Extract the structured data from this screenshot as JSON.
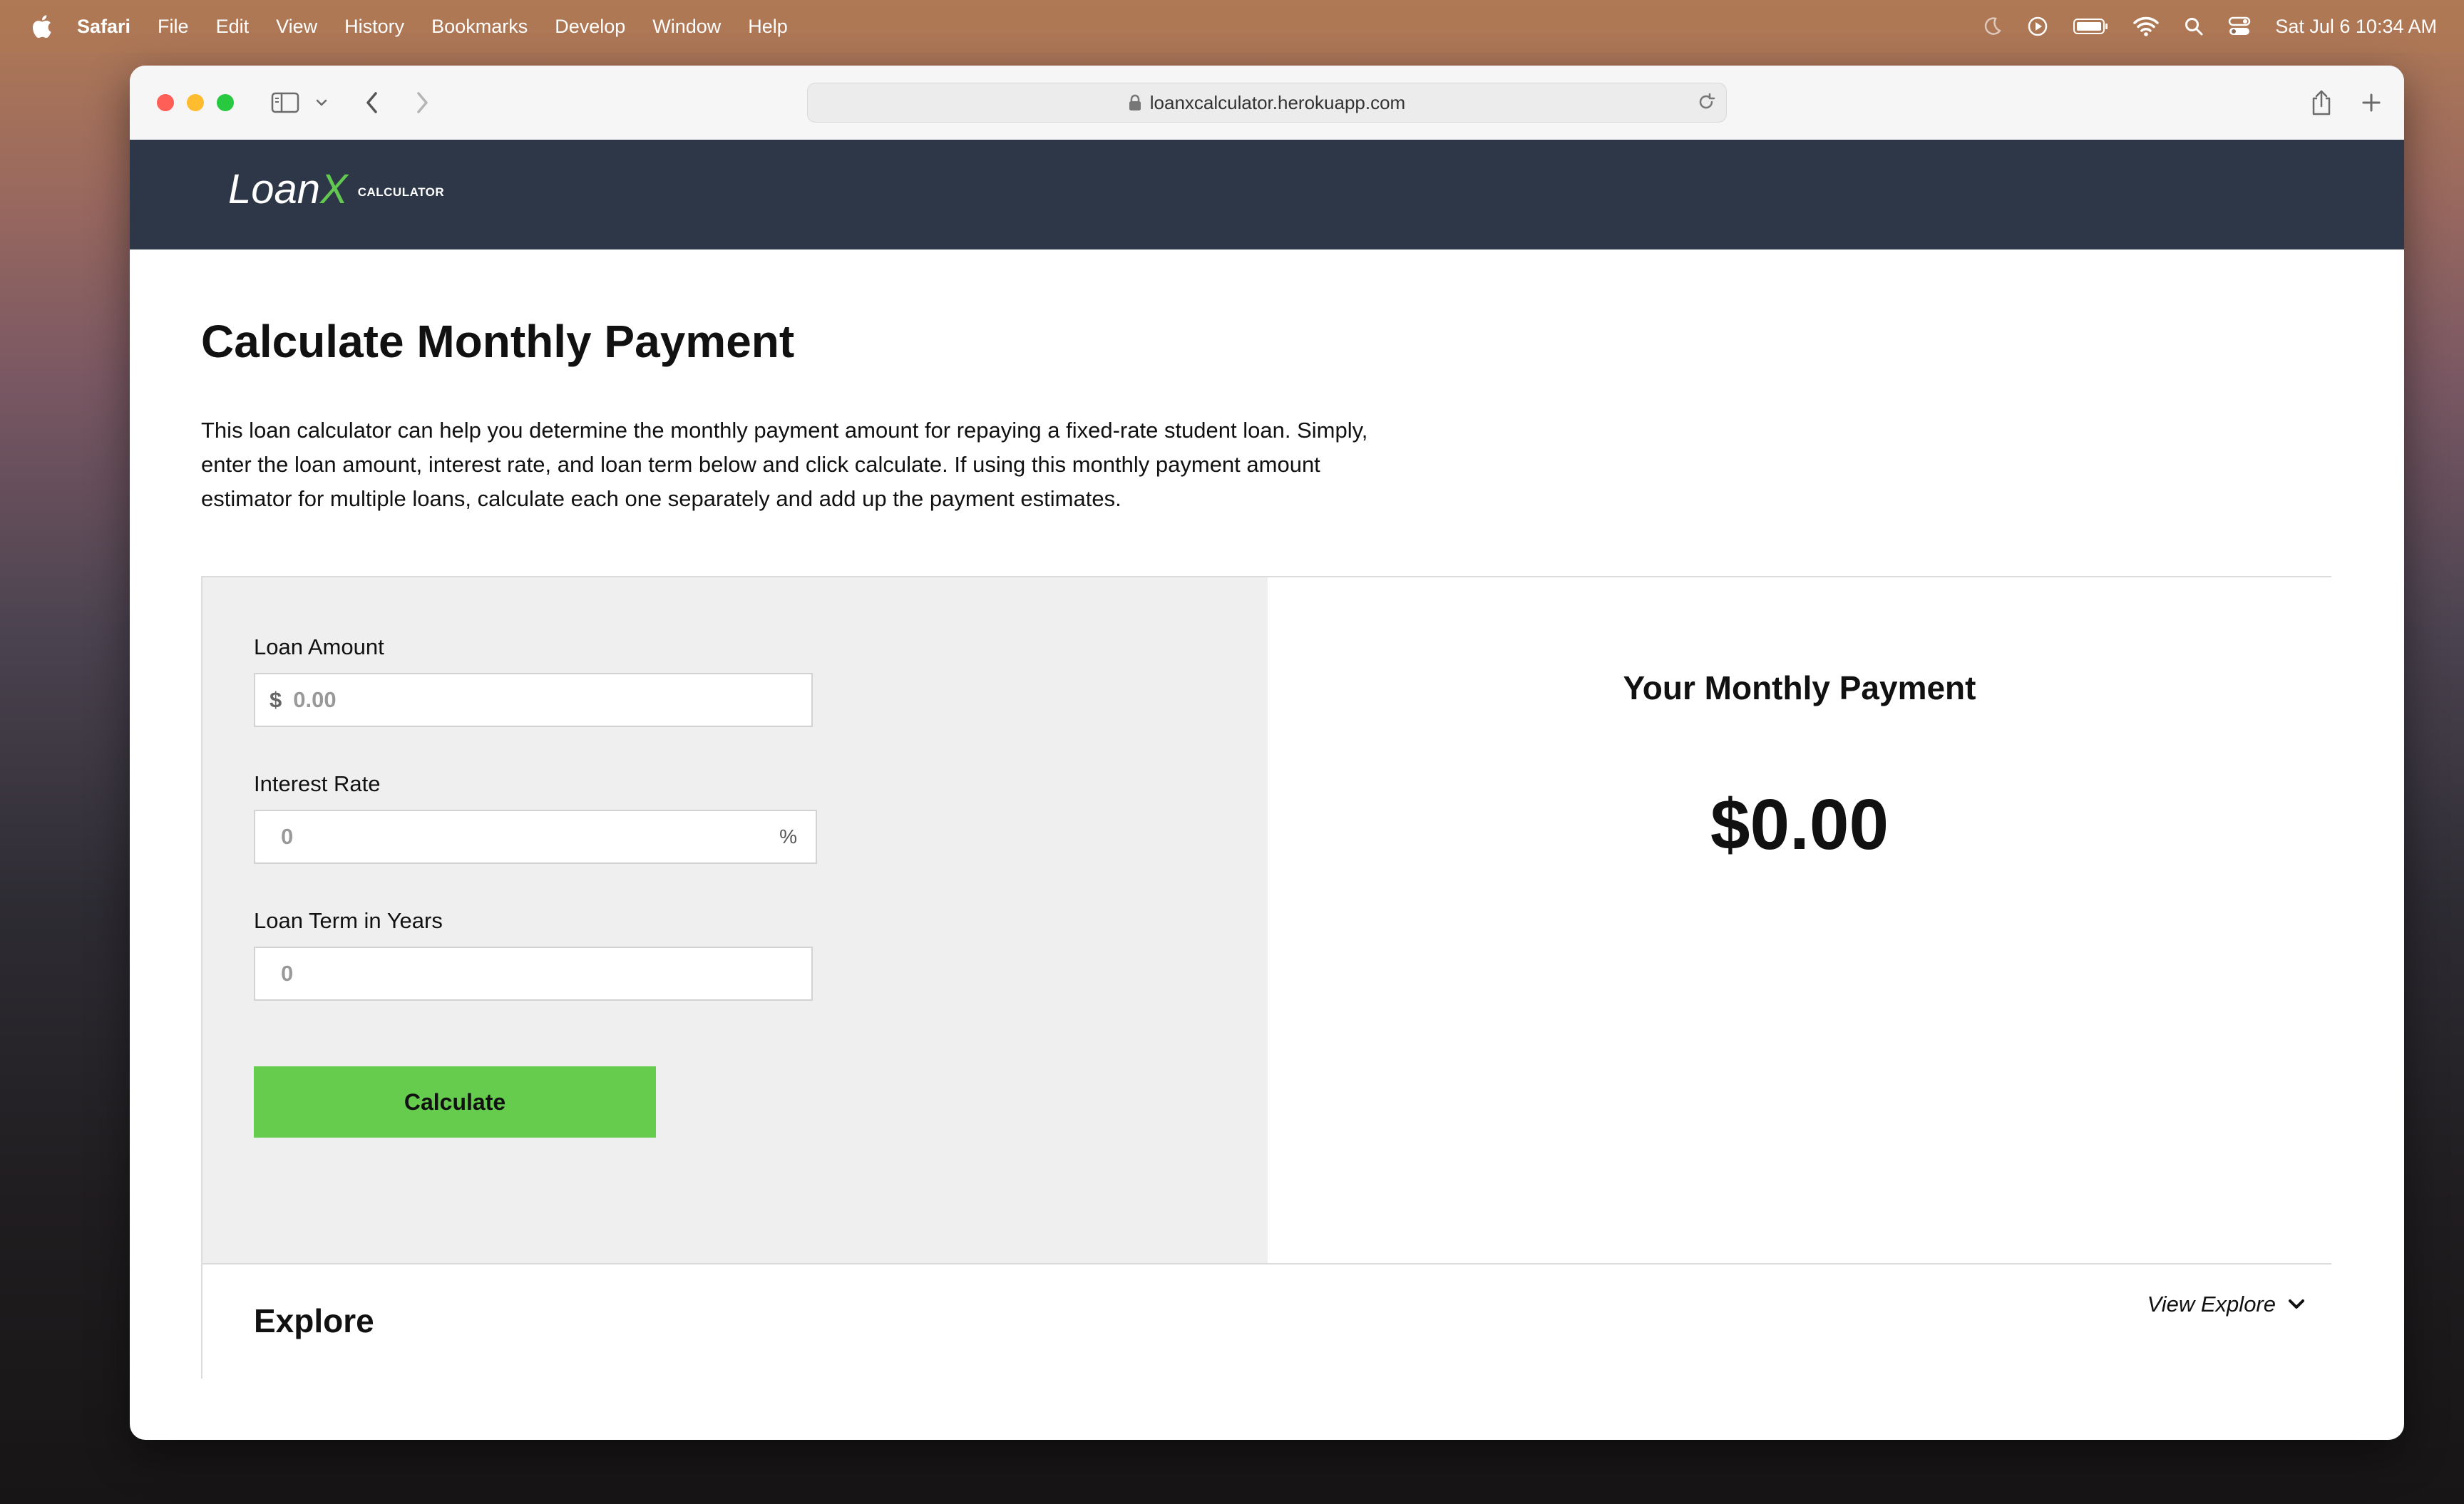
{
  "menubar": {
    "items": [
      "Safari",
      "File",
      "Edit",
      "View",
      "History",
      "Bookmarks",
      "Develop",
      "Window",
      "Help"
    ],
    "datetime": "Sat Jul 6  10:34 AM"
  },
  "browser": {
    "url": "loanxcalculator.herokuapp.com"
  },
  "header": {
    "logo_loan": "Loan",
    "logo_x": "X",
    "logo_sub": "CALCULATOR"
  },
  "main": {
    "title": "Calculate Monthly Payment",
    "intro": "This loan calculator can help you determine the monthly payment amount for repaying a fixed-rate student loan. Simply, enter the loan amount, interest rate, and loan term below and click calculate. If using this monthly payment amount estimator for multiple loans, calculate each one separately and add up the payment estimates."
  },
  "form": {
    "loan_amount": {
      "label": "Loan Amount",
      "prefix": "$",
      "placeholder": "0.00"
    },
    "interest_rate": {
      "label": "Interest Rate",
      "placeholder": "0",
      "suffix": "%"
    },
    "loan_term": {
      "label": "Loan Term in Years",
      "placeholder": "0"
    },
    "calculate_label": "Calculate"
  },
  "result": {
    "title": "Your Monthly Payment",
    "value": "$0.00"
  },
  "explore": {
    "title": "Explore",
    "view_label": "View Explore"
  },
  "colors": {
    "header_bg": "#2d3748",
    "accent_green": "#66cc4d",
    "form_panel_bg": "#efefef"
  }
}
